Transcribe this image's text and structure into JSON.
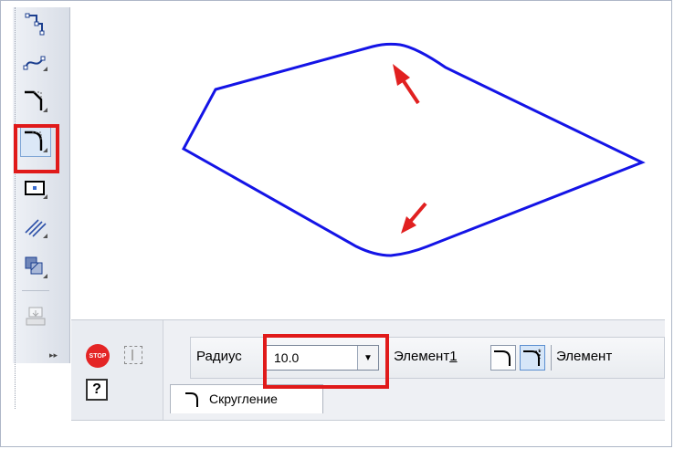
{
  "toolbar": {
    "buttons": [
      {
        "icon": "chamfer-steps-icon"
      },
      {
        "icon": "bezier-curve-icon"
      },
      {
        "icon": "chamfer-icon"
      },
      {
        "icon": "fillet-icon"
      },
      {
        "icon": "rectangle-icon"
      },
      {
        "icon": "hatch-lines-icon"
      },
      {
        "icon": "fill-hatch-icon"
      },
      {
        "icon": "insert-icon"
      }
    ]
  },
  "panel": {
    "stop_icon": "stop-icon",
    "help_icon": "help-icon",
    "radius_label": "Радиус",
    "radius_value": "10.0",
    "element1_label": "Элемент",
    "element1_index": "1",
    "element2_label": "Элемент",
    "tab_label": "Скругление",
    "stop_text": "STOP",
    "help_text": "?"
  }
}
